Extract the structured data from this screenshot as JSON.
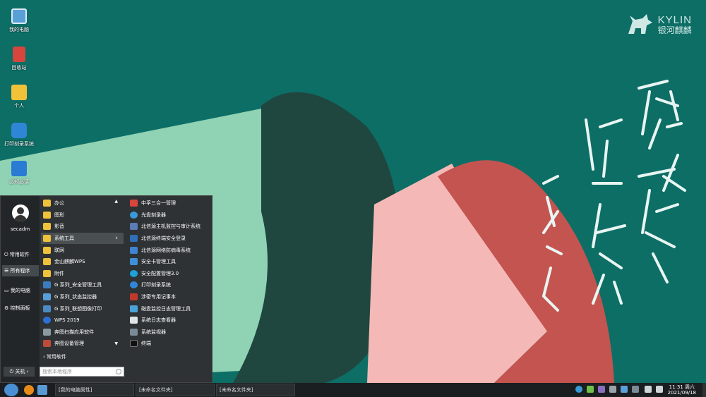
{
  "brand": {
    "word": "KYLIN",
    "sub": "银河麒麟"
  },
  "desktop_icons": [
    {
      "label": "我的电脑",
      "icon": "computer-icon",
      "color": "#5aa0d8"
    },
    {
      "label": "回收站",
      "icon": "trash-icon",
      "color": "#d8453c"
    },
    {
      "label": "个人",
      "icon": "folder-icon",
      "color": "#f0c23a"
    },
    {
      "label": "打印刻录系统",
      "icon": "print-burn-icon",
      "color": "#2f86d6"
    },
    {
      "label": "必知必读",
      "icon": "knowledge-icon",
      "color": "#2a7bd4"
    }
  ],
  "start_menu": {
    "username": "secadm",
    "left_nav": [
      {
        "label": "常用软件",
        "icon": "power-icon"
      },
      {
        "label": "所有程序",
        "icon": "list-icon"
      },
      {
        "label": "我的电脑",
        "icon": "monitor-icon"
      },
      {
        "label": "控制面板",
        "icon": "gear-icon"
      }
    ],
    "shutdown_label": "关机",
    "categories": [
      {
        "label": "办公",
        "icon": "folder-icon"
      },
      {
        "label": "图形",
        "icon": "folder-icon"
      },
      {
        "label": "影音",
        "icon": "folder-icon"
      },
      {
        "label": "系统工具",
        "icon": "folder-icon"
      },
      {
        "label": "联网",
        "icon": "folder-icon"
      },
      {
        "label": "金山麒麟WPS",
        "icon": "folder-icon"
      },
      {
        "label": "附件",
        "icon": "folder-icon"
      },
      {
        "label": "G 系列_安全管理工具",
        "icon": "security-tool-icon"
      },
      {
        "label": "G 系列_状态监控器",
        "icon": "monitor-icon"
      },
      {
        "label": "G 系列_联想图像打印",
        "icon": "printer-icon"
      },
      {
        "label": "WPS 2019",
        "icon": "wps-icon"
      },
      {
        "label": "奔图扫描应用软件",
        "icon": "scanner-icon"
      },
      {
        "label": "奔图设备管理",
        "icon": "device-icon"
      }
    ],
    "bottom_category": "常用软件",
    "submenu": [
      {
        "label": "中孚三合一管理",
        "icon": "zhongfu-icon"
      },
      {
        "label": "光盘刻录器",
        "icon": "disc-icon"
      },
      {
        "label": "北信源主机监控与审计系统",
        "icon": "shield-icon"
      },
      {
        "label": "北信源终端安全登录",
        "icon": "shield-icon"
      },
      {
        "label": "北信源网络防病毒系统",
        "icon": "antivirus-icon"
      },
      {
        "label": "安全卡管理工具",
        "icon": "card-icon"
      },
      {
        "label": "安全配置管理3.0",
        "icon": "config-icon"
      },
      {
        "label": "打印刻录系统",
        "icon": "print-burn-icon"
      },
      {
        "label": "涉密专用记事本",
        "icon": "notepad-icon"
      },
      {
        "label": "磁盘监控日志管理工具",
        "icon": "disk-icon"
      },
      {
        "label": "系统日志查看器",
        "icon": "log-icon"
      },
      {
        "label": "系统监视器",
        "icon": "system-monitor-icon"
      },
      {
        "label": "终端",
        "icon": "terminal-icon"
      }
    ],
    "search_placeholder": "搜索本地程序"
  },
  "taskbar": {
    "windows": [
      {
        "label": "[我的电脑属性]"
      },
      {
        "label": "[未命名文件夹]"
      },
      {
        "label": "[未命名文件夹]"
      }
    ],
    "clock_time": "11:31 周六",
    "clock_date": "2021/09/18"
  },
  "colors": {
    "accent": "#0d6e66",
    "taskbar": "#1b1e20",
    "menu": "#2e3234",
    "folder": "#f0c23a"
  }
}
